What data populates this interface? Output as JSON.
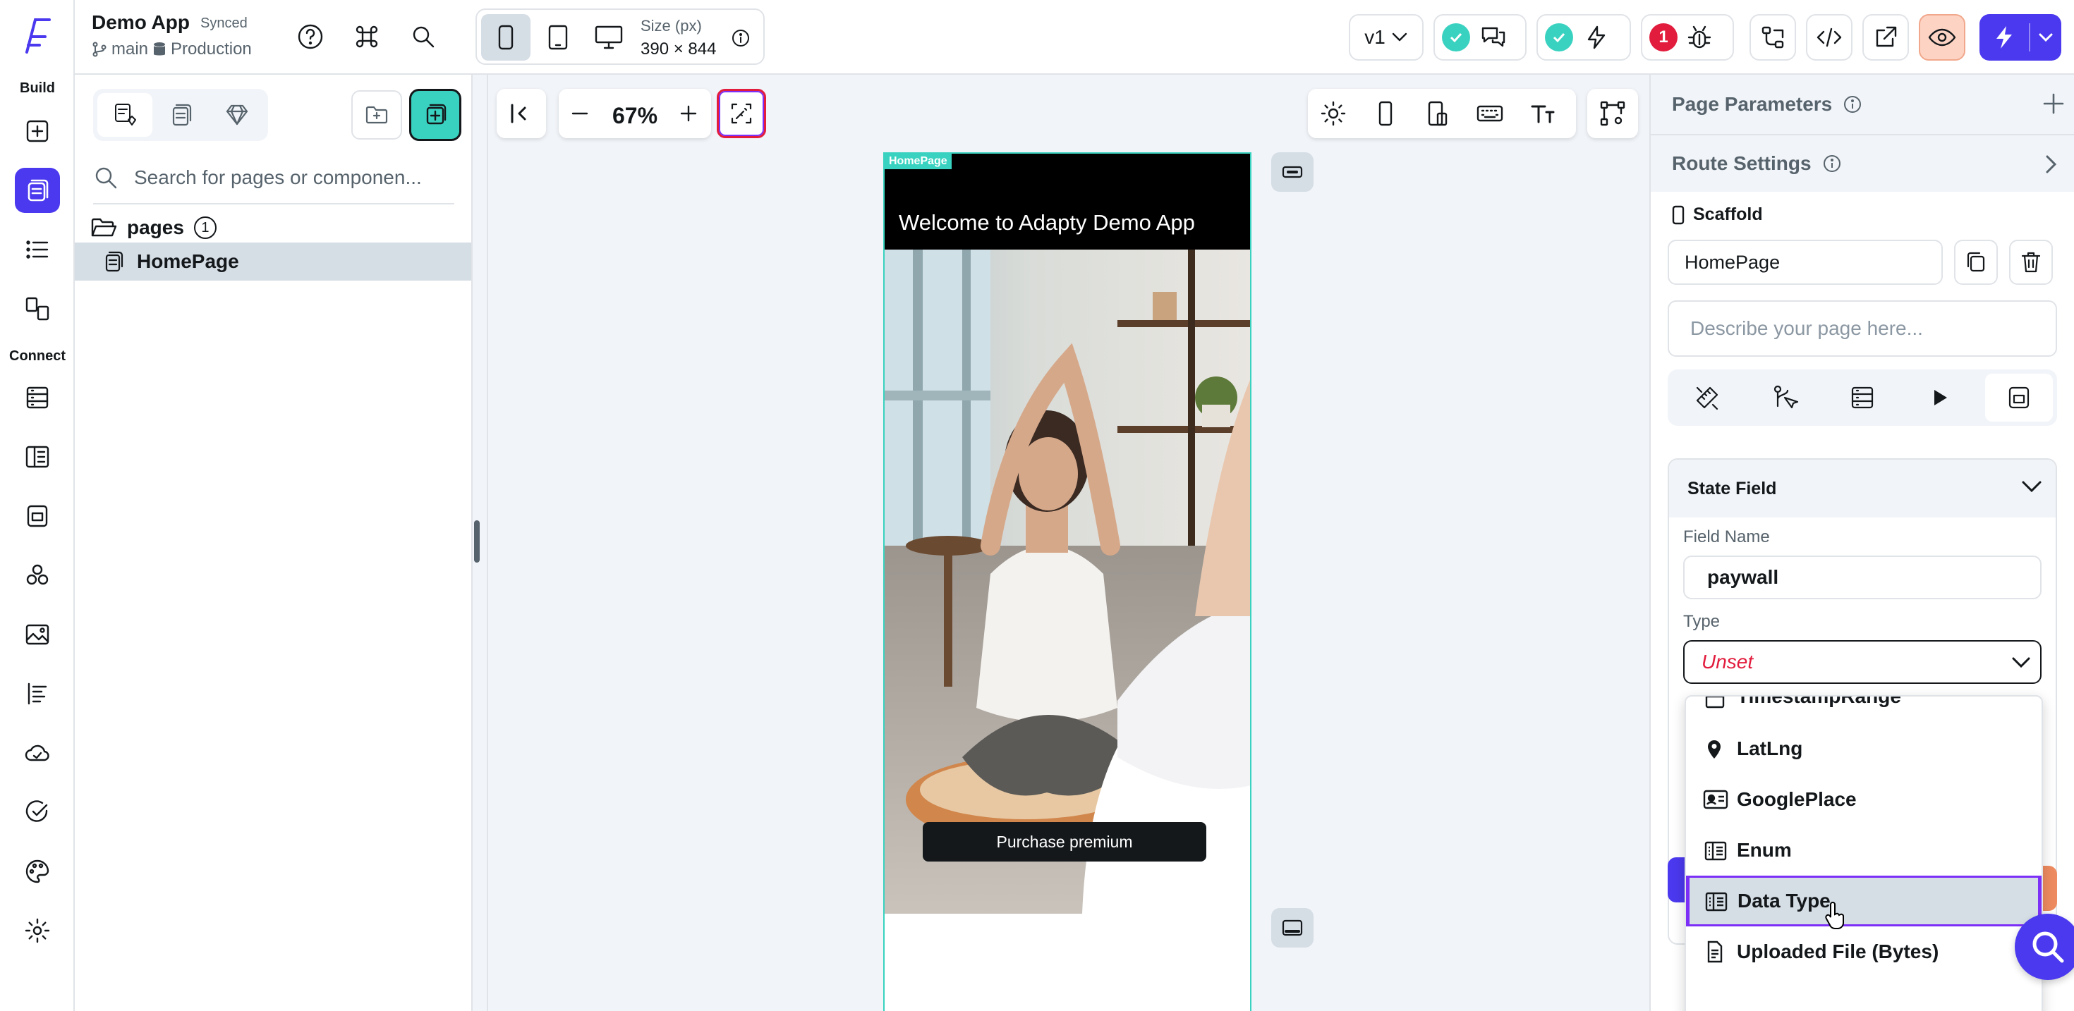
{
  "app": {
    "name": "Demo App",
    "sync_status": "Synced",
    "branch": "main",
    "environment": "Production"
  },
  "rail": {
    "build_label": "Build",
    "connect_label": "Connect"
  },
  "device": {
    "size_label": "Size (px)",
    "size_value": "390 × 844"
  },
  "topbar": {
    "version": "v1",
    "issue_count": "1"
  },
  "pages_panel": {
    "search_placeholder": "Search for pages or componen...",
    "folder_label": "pages",
    "folder_count": "1",
    "page_item": "HomePage"
  },
  "canvas": {
    "zoom": "67%"
  },
  "phone": {
    "tag": "HomePage",
    "appbar_title": "Welcome to Adapty Demo App",
    "button_label": "Purchase premium"
  },
  "right_panel": {
    "page_parameters": "Page Parameters",
    "route_settings": "Route Settings",
    "scaffold_label": "Scaffold",
    "page_name_value": "HomePage",
    "description_placeholder": "Describe your page here...",
    "state_field_title": "State Field",
    "field_name_label": "Field Name",
    "field_name_value": "paywall",
    "type_label": "Type",
    "type_value": "Unset"
  },
  "dropdown": {
    "items": [
      {
        "label": "TimestampRange",
        "icon": "calendar-icon"
      },
      {
        "label": "LatLng",
        "icon": "location-pin-icon"
      },
      {
        "label": "GooglePlace",
        "icon": "contact-card-icon"
      },
      {
        "label": "Enum",
        "icon": "list-icon"
      },
      {
        "label": "Data Type",
        "icon": "list-icon",
        "highlighted": true
      },
      {
        "label": "Uploaded File (Bytes)",
        "icon": "file-upload-icon"
      }
    ]
  },
  "colors": {
    "primary": "#4b39ef",
    "accent_teal": "#39d2c0",
    "error": "#e21c3d",
    "highlight": "#7b2ff7",
    "muted": "#57636c"
  }
}
